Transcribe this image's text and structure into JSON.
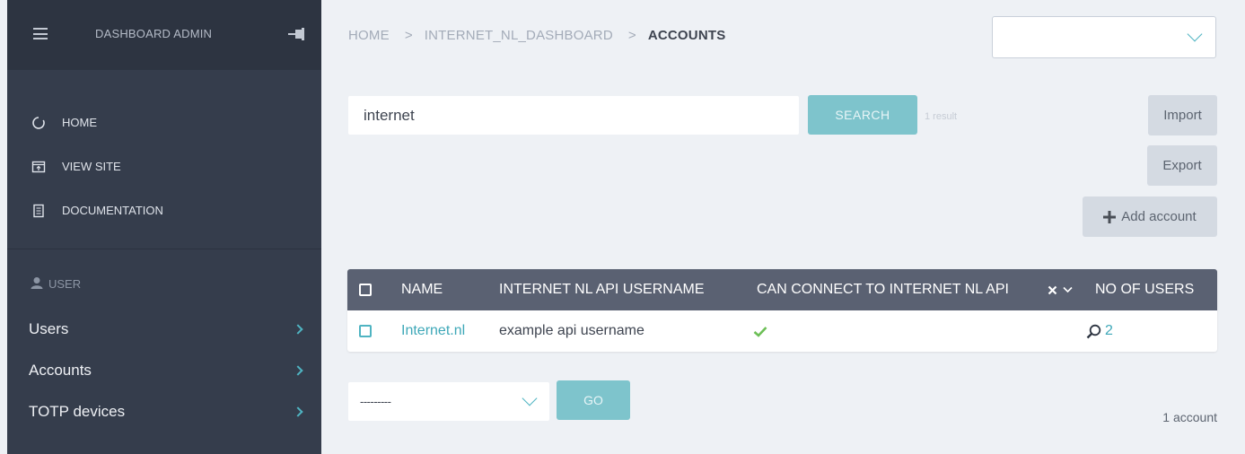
{
  "sidebar": {
    "title": "DASHBOARD ADMIN",
    "links": [
      {
        "label": "HOME",
        "icon": "home-icon"
      },
      {
        "label": "VIEW SITE",
        "icon": "view-site-icon"
      },
      {
        "label": "DOCUMENTATION",
        "icon": "documentation-icon"
      }
    ],
    "section": {
      "label": "USER",
      "icon": "user-icon"
    },
    "models": [
      {
        "label": "Users"
      },
      {
        "label": "Accounts"
      },
      {
        "label": "TOTP devices"
      }
    ]
  },
  "breadcrumb": {
    "items": [
      "HOME",
      "INTERNET_NL_DASHBOARD"
    ],
    "current": "ACCOUNTS",
    "separator": ">"
  },
  "search": {
    "value": "internet",
    "button": "SEARCH",
    "result_count": "1 result"
  },
  "object_tools": {
    "import": "Import",
    "export": "Export",
    "add": "Add account"
  },
  "table": {
    "columns": [
      "NAME",
      "INTERNET NL API USERNAME",
      "CAN CONNECT TO INTERNET NL API",
      "NO OF USERS"
    ],
    "rows": [
      {
        "name": "Internet.nl",
        "api_username": "example api username",
        "can_connect": true,
        "users": "2"
      }
    ]
  },
  "actions": {
    "select_value": "---------",
    "go": "GO"
  },
  "paginator": "1 account",
  "colors": {
    "sidebar_bg": "#353d4c",
    "accent": "#4fb4c2",
    "table_header": "#5a6172",
    "check": "#6cbf56"
  }
}
